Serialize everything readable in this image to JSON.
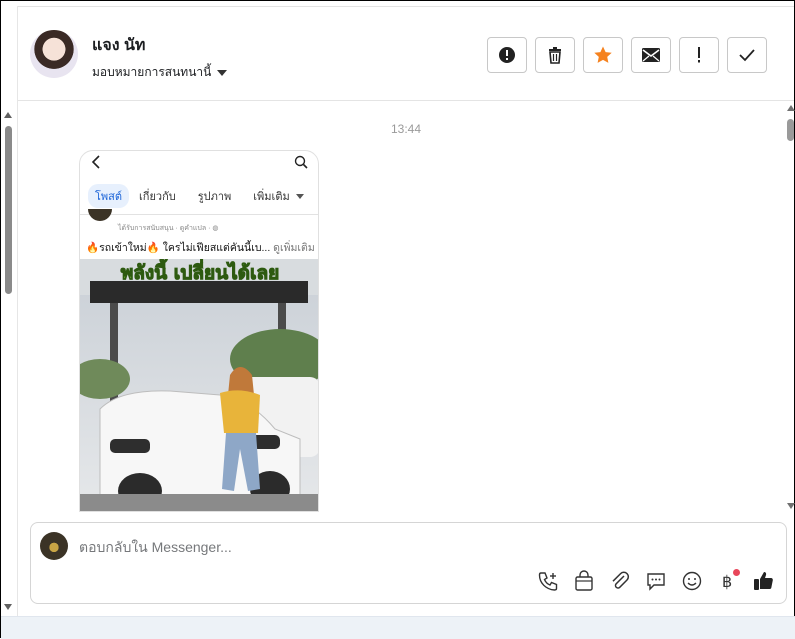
{
  "header": {
    "contact_name": "แจง นัท",
    "assign_label": "มอบหมายการสนทนานี้",
    "actions": [
      {
        "name": "report-button",
        "icon": "alert-circle-icon"
      },
      {
        "name": "delete-button",
        "icon": "trash-icon"
      },
      {
        "name": "star-button",
        "icon": "star-icon"
      },
      {
        "name": "mark-unread-button",
        "icon": "envelope-icon"
      },
      {
        "name": "flag-button",
        "icon": "exclamation-icon"
      },
      {
        "name": "done-button",
        "icon": "check-icon"
      }
    ]
  },
  "chat": {
    "timestamp": "13:44",
    "attachment": {
      "tabs": [
        "โพสต์",
        "เกี่ยวกับ",
        "รูปภาพ",
        "เพิ่มเติม"
      ],
      "active_tab": "โพสต์",
      "page_meta": "ได้รับการสนับสนุน · ดูคำแปล · ",
      "caption": "🔥รถเข้าใหม่🔥 ใครไม่เฟียสแต่คันนี้เบ...",
      "caption_more": "ดูเพิ่มเติม",
      "photo_banner": "พลังนี้ เปลี่ยนได้เลย"
    }
  },
  "composer": {
    "placeholder": "ตอบกลับใน Messenger...",
    "tools": [
      "call-plus-icon",
      "shopping-bag-icon",
      "paperclip-icon",
      "chat-bubble-icon",
      "smiley-icon",
      "baht-icon",
      "thumbs-up-icon"
    ]
  },
  "colors": {
    "star": "#f5821f",
    "accent_blue": "#1a63d8",
    "notify_dot": "#e8465a"
  }
}
